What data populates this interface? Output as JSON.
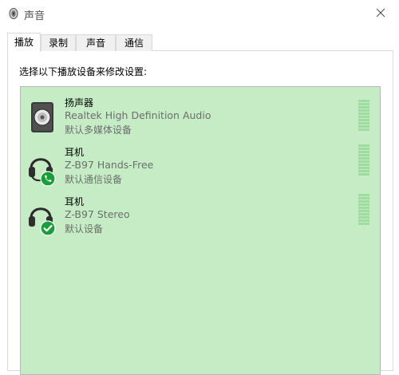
{
  "window": {
    "title": "声音",
    "icon": "speaker-icon"
  },
  "tabs": [
    {
      "label": "播放",
      "active": true
    },
    {
      "label": "录制",
      "active": false
    },
    {
      "label": "声音",
      "active": false
    },
    {
      "label": "通信",
      "active": false
    }
  ],
  "instruction": "选择以下播放设备来修改设置:",
  "devices": [
    {
      "name": "扬声器",
      "description": "Realtek High Definition Audio",
      "status": "默认多媒体设备",
      "icon": "speaker-device-icon",
      "badge": ""
    },
    {
      "name": "耳机",
      "description": "Z-B97 Hands-Free",
      "status": "默认通信设备",
      "icon": "headset-icon",
      "badge": "phone-badge-icon"
    },
    {
      "name": "耳机",
      "description": "Z-B97 Stereo",
      "status": "默认设备",
      "icon": "headset-icon",
      "badge": "checkmark-badge-icon"
    }
  ],
  "colors": {
    "list_background": "#c6ecc6",
    "badge_green": "#1a9e3a",
    "meter": "#9fdc9f"
  }
}
